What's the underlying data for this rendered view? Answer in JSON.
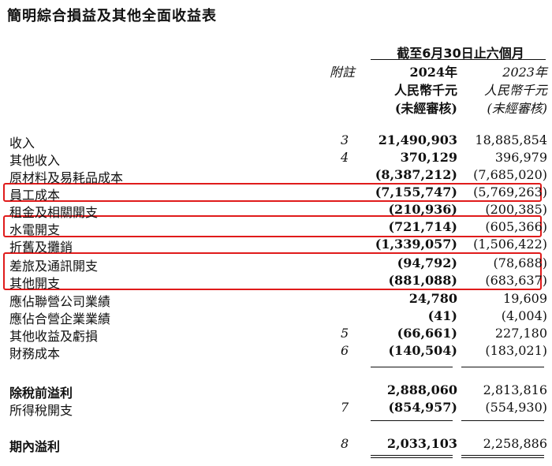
{
  "title": "簡明綜合損益及其他全面收益表",
  "header": {
    "period": "截至6月30日止六個月",
    "note_label": "附註",
    "col_current": {
      "year": "2024年",
      "unit": "人民幣千元",
      "audit": "(未經審核)"
    },
    "col_prior": {
      "year": "2023年",
      "unit": "人民幣千元",
      "audit": "(未經審核)"
    }
  },
  "rows": [
    {
      "label": "收入",
      "note": "3",
      "current": "21,490,903",
      "prior": "18,885,854"
    },
    {
      "label": "其他收入",
      "note": "4",
      "current": "370,129",
      "prior": "396,979"
    },
    {
      "label": "原材料及易耗品成本",
      "note": "",
      "current": "(8,387,212)",
      "prior": "(7,685,020)"
    },
    {
      "label": "員工成本",
      "note": "",
      "current": "(7,155,747)",
      "prior": "(5,769,263)"
    },
    {
      "label": "租金及相關開支",
      "note": "",
      "current": "(210,936)",
      "prior": "(200,385)"
    },
    {
      "label": "水電開支",
      "note": "",
      "current": "(721,714)",
      "prior": "(605,366)"
    },
    {
      "label": "折舊及攤銷",
      "note": "",
      "current": "(1,339,057)",
      "prior": "(1,506,422)"
    },
    {
      "label": "差旅及通訊開支",
      "note": "",
      "current": "(94,792)",
      "prior": "(78,688)"
    },
    {
      "label": "其他開支",
      "note": "",
      "current": "(881,088)",
      "prior": "(683,637)"
    },
    {
      "label": "應佔聯營公司業績",
      "note": "",
      "current": "24,780",
      "prior": "19,609"
    },
    {
      "label": "應佔合營企業業績",
      "note": "",
      "current": "(41)",
      "prior": "(4,004)"
    },
    {
      "label": "其他收益及虧損",
      "note": "5",
      "current": "(66,661)",
      "prior": "227,180"
    },
    {
      "label": "財務成本",
      "note": "6",
      "current": "(140,504)",
      "prior": "(183,021)"
    },
    {
      "label": "除稅前溢利",
      "note": "",
      "current": "2,888,060",
      "prior": "2,813,816"
    },
    {
      "label": "所得稅開支",
      "note": "7",
      "current": "(854,957)",
      "prior": "(554,930)"
    },
    {
      "label": "期內溢利",
      "note": "8",
      "current": "2,033,103",
      "prior": "2,258,886"
    }
  ],
  "highlight_color": "#e01b1b"
}
